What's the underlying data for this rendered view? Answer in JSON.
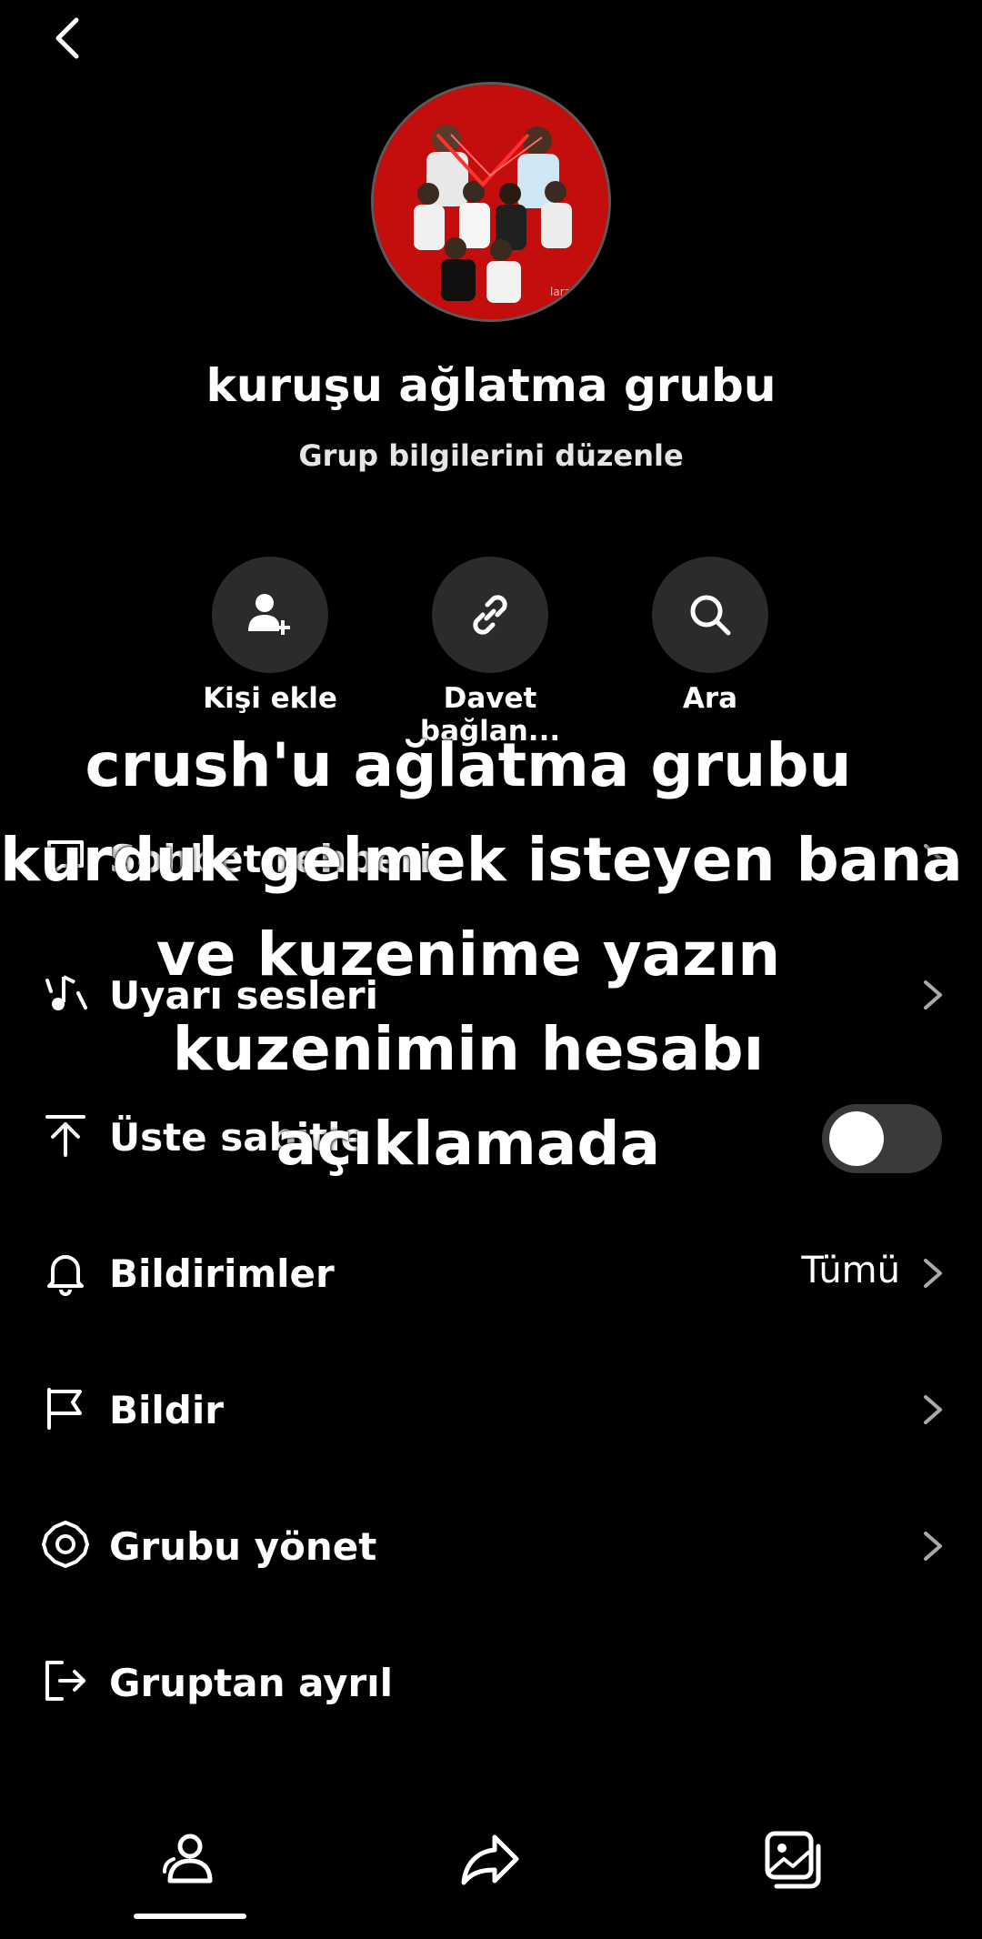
{
  "header": {
    "back_icon": "chevron-left-icon"
  },
  "group": {
    "name": "kuruşu ağlatma grubu",
    "edit_label": "Grup bilgilerini düzenle",
    "avatar_watermark": "lara"
  },
  "actions": [
    {
      "label": "Kişi ekle",
      "icon": "add-person-icon"
    },
    {
      "label": "Davet bağlan...",
      "icon": "link-icon"
    },
    {
      "label": "Ara",
      "icon": "search-icon"
    }
  ],
  "settings": [
    {
      "label": "Sohbet rehberi",
      "icon": "chat-icon"
    },
    {
      "label": "Uyarı sesleri",
      "icon": "music-note-icon"
    },
    {
      "label": "Üste sabitle",
      "icon": "pin-top-icon",
      "toggle_on": false
    },
    {
      "label": "Bildirimler",
      "icon": "bell-icon",
      "value": "Tümü"
    },
    {
      "label": "Bildir",
      "icon": "flag-icon"
    },
    {
      "label": "Grubu yönet",
      "icon": "gear-icon"
    },
    {
      "label": "Gruptan ayrıl",
      "icon": "exit-icon"
    }
  ],
  "overlay_text": [
    "crush'u ağlatma grubu",
    "kurduk gelmek isteyen bana",
    "ve kuzenime yazın",
    "kuzenimin hesabı",
    "açıklamada"
  ],
  "tabs": [
    {
      "name": "members",
      "icon": "people-icon",
      "active": true
    },
    {
      "name": "share",
      "icon": "share-icon",
      "active": false
    },
    {
      "name": "media",
      "icon": "gallery-icon",
      "active": false
    }
  ],
  "colors": {
    "background": "#000000",
    "button_bg": "#2b2b2b",
    "text": "#ffffff"
  }
}
